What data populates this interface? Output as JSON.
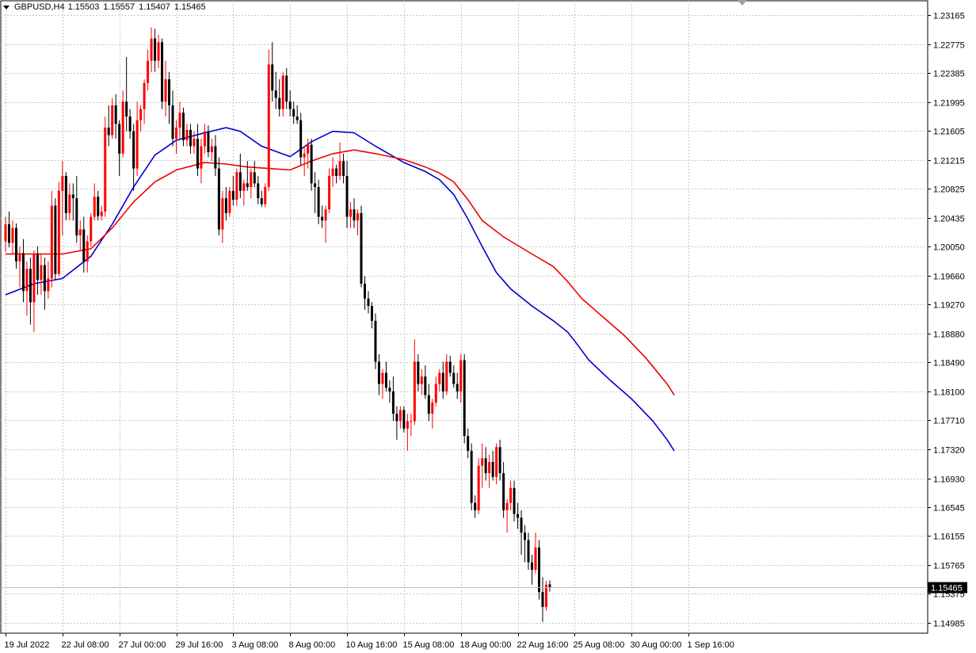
{
  "header": {
    "symbol": "GBPUSD,H4",
    "open": "1.15503",
    "high": "1.15557",
    "low": "1.15407",
    "close": "1.15465"
  },
  "current_price_label": "1.15465",
  "colors": {
    "bull_candle": "#ff0000",
    "bear_candle": "#000000",
    "ma_fast": "#0000cc",
    "ma_slow": "#ee0000",
    "grid": "#c8c8c8",
    "price_line": "#c0c0c0"
  },
  "chart_data": {
    "type": "candlestick",
    "title": "GBPUSD,H4",
    "y_ticks": [
      "1.23165",
      "1.22775",
      "1.22385",
      "1.21995",
      "1.21605",
      "1.21215",
      "1.20825",
      "1.20435",
      "1.20050",
      "1.19660",
      "1.19270",
      "1.18880",
      "1.18490",
      "1.18100",
      "1.17710",
      "1.17320",
      "1.16930",
      "1.16545",
      "1.16155",
      "1.15765",
      "1.15375",
      "1.14985"
    ],
    "ylim": [
      1.1479,
      1.2336
    ],
    "x_ticks": [
      "19 Jul 2022",
      "22 Jul 08:00",
      "27 Jul 00:00",
      "29 Jul 16:00",
      "3 Aug 08:00",
      "8 Aug 00:00",
      "10 Aug 16:00",
      "15 Aug 08:00",
      "18 Aug 00:00",
      "22 Aug 16:00",
      "25 Aug 08:00",
      "30 Aug 00:00",
      "1 Sep 16:00"
    ],
    "x_tick_bars": [
      0,
      16,
      32,
      48,
      64,
      80,
      96,
      112,
      128,
      144,
      160,
      176,
      192
    ],
    "grid": true,
    "current_price": 1.15465,
    "bars": [
      [
        1.2012,
        1.2045,
        1.1998,
        1.2035
      ],
      [
        1.2035,
        1.2052,
        1.2004,
        1.201
      ],
      [
        1.201,
        1.204,
        1.1995,
        1.203
      ],
      [
        1.203,
        1.2036,
        1.1975,
        1.1985
      ],
      [
        1.1985,
        1.2005,
        1.195,
        1.1996
      ],
      [
        1.1996,
        1.2015,
        1.193,
        1.1945
      ],
      [
        1.1945,
        1.1985,
        1.1912,
        1.1975
      ],
      [
        1.1975,
        1.199,
        1.19,
        1.193
      ],
      [
        1.193,
        1.2,
        1.189,
        1.1995
      ],
      [
        1.1995,
        1.2005,
        1.194,
        1.196
      ],
      [
        1.196,
        1.1995,
        1.194,
        1.198
      ],
      [
        1.198,
        1.199,
        1.192,
        1.1945
      ],
      [
        1.1945,
        1.1985,
        1.1935,
        1.1962
      ],
      [
        1.1962,
        1.208,
        1.195,
        1.206
      ],
      [
        1.206,
        1.207,
        1.196,
        1.1968
      ],
      [
        1.1968,
        1.2092,
        1.1965,
        1.208
      ],
      [
        1.208,
        1.212,
        1.202,
        1.21
      ],
      [
        1.21,
        1.2105,
        1.204,
        1.205
      ],
      [
        1.205,
        1.209,
        1.204,
        1.2075
      ],
      [
        1.2075,
        1.209,
        1.204,
        1.207
      ],
      [
        1.207,
        1.21,
        1.201,
        1.202
      ],
      [
        1.202,
        1.204,
        1.2,
        1.2028
      ],
      [
        1.2028,
        1.2045,
        1.197,
        1.1985
      ],
      [
        1.1985,
        1.202,
        1.197,
        1.2012
      ],
      [
        1.2012,
        1.205,
        1.2005,
        1.2045
      ],
      [
        1.2045,
        1.209,
        1.204,
        1.2072
      ],
      [
        1.2072,
        1.208,
        1.204,
        1.2046
      ],
      [
        1.2046,
        1.206,
        1.204,
        1.2052
      ],
      [
        1.2052,
        1.218,
        1.2045,
        1.2165
      ],
      [
        1.2165,
        1.2195,
        1.214,
        1.2155
      ],
      [
        1.2155,
        1.2205,
        1.215,
        1.2195
      ],
      [
        1.2195,
        1.221,
        1.215,
        1.217
      ],
      [
        1.217,
        1.2175,
        1.21,
        1.213
      ],
      [
        1.213,
        1.2215,
        1.2125,
        1.22
      ],
      [
        1.22,
        1.226,
        1.216,
        1.218
      ],
      [
        1.218,
        1.219,
        1.215,
        1.216
      ],
      [
        1.216,
        1.217,
        1.208,
        1.211
      ],
      [
        1.211,
        1.22,
        1.21,
        1.2175
      ],
      [
        1.2175,
        1.2195,
        1.216,
        1.219
      ],
      [
        1.219,
        1.223,
        1.217,
        1.2225
      ],
      [
        1.2225,
        1.227,
        1.2215,
        1.2255
      ],
      [
        1.2255,
        1.23,
        1.224,
        1.2285
      ],
      [
        1.2285,
        1.2298,
        1.224,
        1.2255
      ],
      [
        1.2255,
        1.229,
        1.2245,
        1.228
      ],
      [
        1.228,
        1.2285,
        1.219,
        1.22
      ],
      [
        1.22,
        1.2255,
        1.218,
        1.223
      ],
      [
        1.223,
        1.224,
        1.217,
        1.2195
      ],
      [
        1.2195,
        1.2215,
        1.214,
        1.215
      ],
      [
        1.215,
        1.2175,
        1.213,
        1.2165
      ],
      [
        1.2165,
        1.22,
        1.215,
        1.2185
      ],
      [
        1.2185,
        1.2192,
        1.214,
        1.2148
      ],
      [
        1.2148,
        1.217,
        1.214,
        1.2162
      ],
      [
        1.2162,
        1.217,
        1.213,
        1.214
      ],
      [
        1.214,
        1.216,
        1.213,
        1.215
      ],
      [
        1.215,
        1.217,
        1.21,
        1.211
      ],
      [
        1.211,
        1.215,
        1.209,
        1.214
      ],
      [
        1.214,
        1.217,
        1.213,
        1.216
      ],
      [
        1.216,
        1.2168,
        1.2125,
        1.2132
      ],
      [
        1.2132,
        1.215,
        1.212,
        1.214
      ],
      [
        1.214,
        1.2155,
        1.21,
        1.211
      ],
      [
        1.211,
        1.2125,
        1.202,
        1.2028
      ],
      [
        1.2028,
        1.208,
        1.201,
        1.207
      ],
      [
        1.207,
        1.2085,
        1.204,
        1.205
      ],
      [
        1.205,
        1.2085,
        1.2045,
        1.208
      ],
      [
        1.208,
        1.21,
        1.206,
        1.2068
      ],
      [
        1.2068,
        1.211,
        1.206,
        1.2105
      ],
      [
        1.2105,
        1.213,
        1.207,
        1.208
      ],
      [
        1.208,
        1.2095,
        1.206,
        1.209
      ],
      [
        1.209,
        1.212,
        1.208,
        1.2085
      ],
      [
        1.2085,
        1.211,
        1.207,
        1.2105
      ],
      [
        1.2105,
        1.212,
        1.2085,
        1.209
      ],
      [
        1.209,
        1.21,
        1.2062,
        1.207
      ],
      [
        1.207,
        1.208,
        1.2058,
        1.2062
      ],
      [
        1.2062,
        1.209,
        1.2058,
        1.2085
      ],
      [
        1.2085,
        1.227,
        1.208,
        1.225
      ],
      [
        1.225,
        1.228,
        1.22,
        1.2215
      ],
      [
        1.2215,
        1.224,
        1.219,
        1.2205
      ],
      [
        1.2205,
        1.223,
        1.218,
        1.219
      ],
      [
        1.219,
        1.224,
        1.218,
        1.2235
      ],
      [
        1.2235,
        1.2245,
        1.219,
        1.22
      ],
      [
        1.22,
        1.2215,
        1.218,
        1.219
      ],
      [
        1.219,
        1.22,
        1.217,
        1.218
      ],
      [
        1.218,
        1.2195,
        1.217,
        1.2175
      ],
      [
        1.2175,
        1.2185,
        1.2115,
        1.2125
      ],
      [
        1.2125,
        1.214,
        1.21,
        1.213
      ],
      [
        1.213,
        1.215,
        1.211,
        1.2142
      ],
      [
        1.2142,
        1.215,
        1.208,
        1.209
      ],
      [
        1.209,
        1.2105,
        1.205,
        1.2085
      ],
      [
        1.2085,
        1.2095,
        1.2035,
        1.2045
      ],
      [
        1.2045,
        1.206,
        1.203,
        1.204
      ],
      [
        1.204,
        1.206,
        1.201,
        1.2055
      ],
      [
        1.2055,
        1.211,
        1.205,
        1.21
      ],
      [
        1.21,
        1.2125,
        1.2085,
        1.211
      ],
      [
        1.211,
        1.2115,
        1.209,
        1.21
      ],
      [
        1.21,
        1.2145,
        1.2095,
        1.212
      ],
      [
        1.212,
        1.213,
        1.209,
        1.21
      ],
      [
        1.21,
        1.212,
        1.203,
        1.2045
      ],
      [
        1.2045,
        1.2065,
        1.203,
        1.2055
      ],
      [
        1.2055,
        1.207,
        1.203,
        1.204
      ],
      [
        1.204,
        1.2055,
        1.202,
        1.205
      ],
      [
        1.205,
        1.206,
        1.195,
        1.1955
      ],
      [
        1.1955,
        1.1965,
        1.192,
        1.1935
      ],
      [
        1.1935,
        1.1945,
        1.1915,
        1.1925
      ],
      [
        1.1925,
        1.193,
        1.1895,
        1.1905
      ],
      [
        1.1905,
        1.1915,
        1.184,
        1.185
      ],
      [
        1.185,
        1.186,
        1.1805,
        1.182
      ],
      [
        1.182,
        1.184,
        1.18,
        1.1835
      ],
      [
        1.1835,
        1.185,
        1.181,
        1.1815
      ],
      [
        1.1815,
        1.1825,
        1.1795,
        1.181
      ],
      [
        1.181,
        1.183,
        1.177,
        1.178
      ],
      [
        1.178,
        1.179,
        1.1745,
        1.177
      ],
      [
        1.177,
        1.179,
        1.176,
        1.1785
      ],
      [
        1.1785,
        1.179,
        1.1755,
        1.176
      ],
      [
        1.176,
        1.178,
        1.173,
        1.177
      ],
      [
        1.177,
        1.178,
        1.175,
        1.177
      ],
      [
        1.177,
        1.188,
        1.1765,
        1.185
      ],
      [
        1.185,
        1.186,
        1.181,
        1.182
      ],
      [
        1.182,
        1.184,
        1.1805,
        1.183
      ],
      [
        1.183,
        1.1845,
        1.18,
        1.1805
      ],
      [
        1.1805,
        1.182,
        1.177,
        1.178
      ],
      [
        1.178,
        1.18,
        1.176,
        1.1795
      ],
      [
        1.1795,
        1.183,
        1.179,
        1.182
      ],
      [
        1.182,
        1.184,
        1.181,
        1.1835
      ],
      [
        1.1835,
        1.185,
        1.18,
        1.181
      ],
      [
        1.181,
        1.186,
        1.1805,
        1.185
      ],
      [
        1.185,
        1.1858,
        1.183,
        1.1835
      ],
      [
        1.1835,
        1.1845,
        1.1815,
        1.182
      ],
      [
        1.182,
        1.1835,
        1.18,
        1.181
      ],
      [
        1.181,
        1.186,
        1.1795,
        1.1852
      ],
      [
        1.1852,
        1.186,
        1.174,
        1.175
      ],
      [
        1.175,
        1.176,
        1.172,
        1.173
      ],
      [
        1.173,
        1.174,
        1.165,
        1.166
      ],
      [
        1.166,
        1.167,
        1.164,
        1.165
      ],
      [
        1.165,
        1.172,
        1.1645,
        1.171
      ],
      [
        1.171,
        1.174,
        1.168,
        1.172
      ],
      [
        1.172,
        1.1735,
        1.169,
        1.17
      ],
      [
        1.17,
        1.1725,
        1.168,
        1.1715
      ],
      [
        1.1715,
        1.173,
        1.169,
        1.1695
      ],
      [
        1.1695,
        1.174,
        1.1685,
        1.1735
      ],
      [
        1.1735,
        1.1745,
        1.169,
        1.17
      ],
      [
        1.17,
        1.1715,
        1.164,
        1.165
      ],
      [
        1.165,
        1.1665,
        1.162,
        1.166
      ],
      [
        1.166,
        1.169,
        1.165,
        1.168
      ],
      [
        1.168,
        1.169,
        1.1635,
        1.1645
      ],
      [
        1.1645,
        1.166,
        1.1625,
        1.164
      ],
      [
        1.164,
        1.165,
        1.159,
        1.162
      ],
      [
        1.162,
        1.163,
        1.158,
        1.161
      ],
      [
        1.161,
        1.162,
        1.157,
        1.158
      ],
      [
        1.158,
        1.159,
        1.155,
        1.157
      ],
      [
        1.157,
        1.162,
        1.1565,
        1.16
      ],
      [
        1.16,
        1.161,
        1.153,
        1.154
      ],
      [
        1.154,
        1.156,
        1.15,
        1.152
      ],
      [
        1.152,
        1.1555,
        1.1515,
        1.155
      ],
      [
        1.15503,
        1.15557,
        1.15407,
        1.15465
      ]
    ],
    "moving_averages": [
      {
        "points": [
          [
            0,
            1.194
          ],
          [
            8,
            1.1955
          ],
          [
            16,
            1.1962
          ],
          [
            24,
            1.1992
          ],
          [
            30,
            1.2035
          ],
          [
            36,
            1.2085
          ],
          [
            42,
            1.2128
          ],
          [
            48,
            1.2148
          ],
          [
            56,
            1.2158
          ],
          [
            62,
            1.2165
          ],
          [
            66,
            1.216
          ],
          [
            72,
            1.214
          ],
          [
            80,
            1.2126
          ],
          [
            86,
            1.2146
          ],
          [
            92,
            1.216
          ],
          [
            98,
            1.2158
          ],
          [
            104,
            1.214
          ],
          [
            112,
            1.2118
          ],
          [
            118,
            1.2106
          ],
          [
            122,
            1.2095
          ],
          [
            126,
            1.2075
          ],
          [
            130,
            1.2042
          ],
          [
            134,
            1.2005
          ],
          [
            138,
            1.197
          ],
          [
            142,
            1.1948
          ],
          [
            148,
            1.1925
          ],
          [
            154,
            1.1905
          ],
          [
            158,
            1.189
          ],
          [
            160,
            1.1878
          ],
          [
            164,
            1.1852
          ],
          [
            170,
            1.1825
          ],
          [
            176,
            1.18
          ],
          [
            182,
            1.177
          ],
          [
            186,
            1.1745
          ],
          [
            188,
            1.173
          ]
        ]
      },
      {
        "points": [
          [
            0,
            1.1995
          ],
          [
            8,
            1.1995
          ],
          [
            16,
            1.1995
          ],
          [
            24,
            1.2002
          ],
          [
            30,
            1.203
          ],
          [
            36,
            1.2065
          ],
          [
            42,
            1.2092
          ],
          [
            48,
            1.2108
          ],
          [
            56,
            1.2118
          ],
          [
            62,
            1.2116
          ],
          [
            68,
            1.2112
          ],
          [
            74,
            1.211
          ],
          [
            80,
            1.2108
          ],
          [
            86,
            1.212
          ],
          [
            92,
            1.213
          ],
          [
            98,
            1.2135
          ],
          [
            104,
            1.213
          ],
          [
            112,
            1.2122
          ],
          [
            118,
            1.2112
          ],
          [
            122,
            1.2104
          ],
          [
            126,
            1.2092
          ],
          [
            130,
            1.2068
          ],
          [
            134,
            1.204
          ],
          [
            140,
            1.2018
          ],
          [
            148,
            1.1995
          ],
          [
            154,
            1.1978
          ],
          [
            158,
            1.1958
          ],
          [
            162,
            1.1935
          ],
          [
            168,
            1.191
          ],
          [
            174,
            1.1885
          ],
          [
            180,
            1.1855
          ],
          [
            186,
            1.182
          ],
          [
            188,
            1.1805
          ]
        ]
      }
    ]
  }
}
